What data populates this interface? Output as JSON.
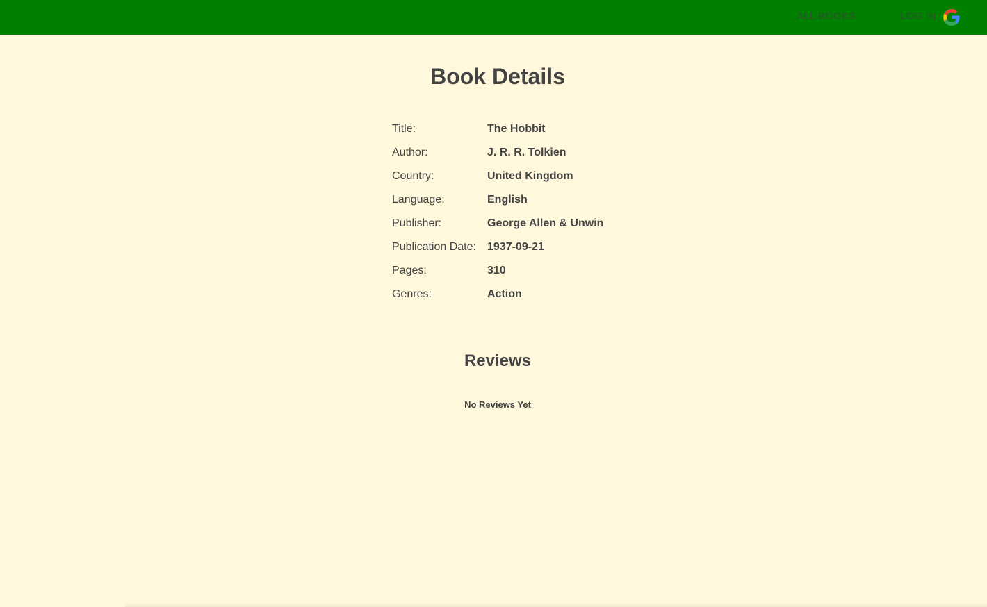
{
  "nav": {
    "all_books": "ALL BOOKS",
    "login": "LOG IN",
    "login_icon": "google-icon"
  },
  "page": {
    "title": "Book Details"
  },
  "details": [
    {
      "label": "Title:",
      "value": "The Hobbit"
    },
    {
      "label": "Author:",
      "value": "J. R. R. Tolkien"
    },
    {
      "label": "Country:",
      "value": "United Kingdom"
    },
    {
      "label": "Language:",
      "value": "English"
    },
    {
      "label": "Publisher:",
      "value": "George Allen & Unwin"
    },
    {
      "label": "Publication Date:",
      "value": "1937-09-21"
    },
    {
      "label": "Pages:",
      "value": "310"
    },
    {
      "label": "Genres:",
      "value": "Action"
    }
  ],
  "reviews": {
    "title": "Reviews",
    "empty_text": "No Reviews Yet"
  },
  "colors": {
    "navbar": "#008000",
    "background": "#fff8dc",
    "text": "#444444"
  }
}
